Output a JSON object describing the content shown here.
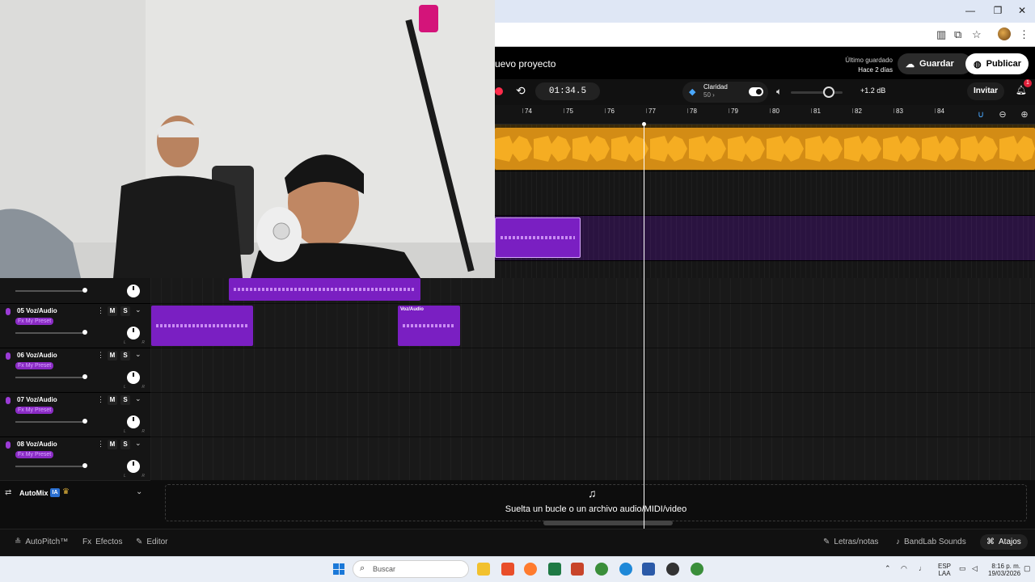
{
  "browser": {
    "minimize": "—",
    "maximize": "❐",
    "close": "✕"
  },
  "header": {
    "project_title": "uevo proyecto",
    "last_saved_label": "Último guardado",
    "last_saved_value": "Hace 2 días",
    "save_label": "Guardar",
    "publish_label": "Publicar"
  },
  "transport": {
    "time": "01:34.5",
    "clarity_label": "Claridad",
    "clarity_value": "50 ›",
    "volume_db": "+1.2 dB",
    "invite_label": "Invitar",
    "notifications": "1"
  },
  "ruler": {
    "bars": [
      "74",
      "75",
      "76",
      "77",
      "78",
      "79",
      "80",
      "81",
      "82",
      "83",
      "84"
    ]
  },
  "tracks": [
    {
      "name": "05 Voz/Audio",
      "fx": "Fx My Preset",
      "mute": "M",
      "solo": "S"
    },
    {
      "name": "06 Voz/Audio",
      "fx": "Fx My Preset",
      "mute": "M",
      "solo": "S"
    },
    {
      "name": "07 Voz/Audio",
      "fx": "Fx My Preset",
      "mute": "M",
      "solo": "S"
    },
    {
      "name": "08 Voz/Audio",
      "fx": "Fx My Preset",
      "mute": "M",
      "solo": "S"
    }
  ],
  "pan_labels": {
    "left": "L",
    "right": "R"
  },
  "clips": {
    "track05_label": "Voz/Audio"
  },
  "automix": {
    "label": "AutoMix",
    "badge": "IA"
  },
  "dropzone": {
    "text": "Suelta un bucle o un archivo audio/MIDI/video"
  },
  "bottombar": {
    "autopitch": "AutoPitch™",
    "effects": "Efectos",
    "editor": "Editor",
    "lyrics": "Letras/notas",
    "sounds": "BandLab Sounds",
    "shortcuts": "Atajos"
  },
  "taskbar": {
    "search_placeholder": "Buscar",
    "lang_line1": "ESP",
    "lang_line2": "LAA",
    "time": "8:16 p. m.",
    "date": "19/03/2026"
  },
  "colors": {
    "accent_purple": "#7a1fc2",
    "beat_orange": "#d38c15",
    "record_red": "#ff2b4a"
  }
}
